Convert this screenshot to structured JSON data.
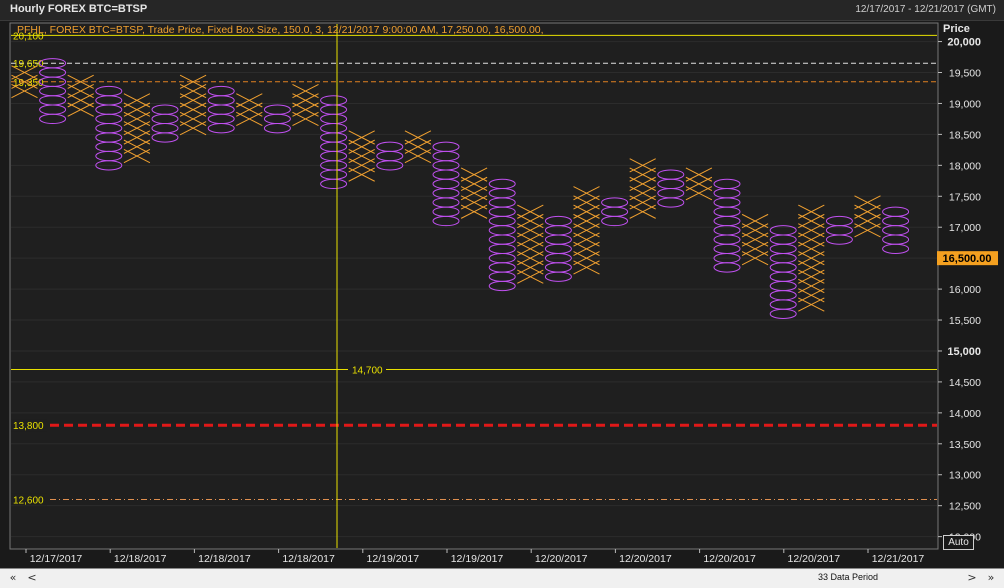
{
  "window": {
    "title": "Hourly FOREX BTC=BTSP",
    "date_range": "12/17/2017 - 12/21/2017 (GMT)"
  },
  "legend_text": "PFHL, FOREX BTC=BTSP, Trade Price, Fixed Box Size, 150.0, 3,  12/21/2017 9:00:00 AM, 17,250.00, 16,500.00,",
  "price_axis_title": "Price",
  "current_price_label": "16,500.00",
  "auto_button_label": "Auto",
  "scrollbar": {
    "first_label": "«",
    "prev_label": "<",
    "status_text": "33 Data Period",
    "next_label": ">",
    "last_label": "»"
  },
  "colors": {
    "background": "#1f1f1f",
    "x_mark": "#f0a030",
    "o_mark": "#c050f0",
    "yellow_line": "#e8e000",
    "red_dashed": "#e01818",
    "orange_dotdash": "#e09050",
    "white_dashed": "#e0e0e0",
    "orange_dashed": "#e08020",
    "current_price_bg": "#f4a020"
  },
  "chart_data": {
    "type": "point-and-figure",
    "box_size": 150,
    "reversal": 3,
    "ylim": [
      11800,
      20300
    ],
    "y_ticks": [
      12000,
      12500,
      13000,
      13500,
      14000,
      14500,
      15000,
      15500,
      16000,
      16500,
      17000,
      17500,
      18000,
      18500,
      19000,
      19500,
      20000
    ],
    "y_tick_labels": [
      "12,000",
      "12,500",
      "13,000",
      "13,500",
      "14,000",
      "14,500",
      "15,000",
      "15,500",
      "16,000",
      "16,500",
      "17,000",
      "17,500",
      "18,000",
      "18,500",
      "19,000",
      "19,500",
      "20,000"
    ],
    "bold_ticks": [
      15000,
      20000
    ],
    "x_labels": [
      "12/17/2017",
      "12/18/2017",
      "12/18/2017",
      "12/18/2017",
      "12/19/2017",
      "12/19/2017",
      "12/20/2017",
      "12/20/2017",
      "12/20/2017",
      "12/20/2017",
      "12/21/2017"
    ],
    "columns": [
      {
        "type": "X",
        "low": 19200,
        "high": 19500
      },
      {
        "type": "O",
        "low": 18750,
        "high": 19650
      },
      {
        "type": "X",
        "low": 18900,
        "high": 19350
      },
      {
        "type": "O",
        "low": 18000,
        "high": 19200
      },
      {
        "type": "X",
        "low": 18150,
        "high": 19050
      },
      {
        "type": "O",
        "low": 18450,
        "high": 18900
      },
      {
        "type": "X",
        "low": 18600,
        "high": 19350
      },
      {
        "type": "O",
        "low": 18600,
        "high": 19200
      },
      {
        "type": "X",
        "low": 18750,
        "high": 19050
      },
      {
        "type": "O",
        "low": 18600,
        "high": 18900
      },
      {
        "type": "X",
        "low": 18750,
        "high": 19200
      },
      {
        "type": "O",
        "low": 17700,
        "high": 19050
      },
      {
        "type": "X",
        "low": 17850,
        "high": 18450
      },
      {
        "type": "O",
        "low": 18000,
        "high": 18300
      },
      {
        "type": "X",
        "low": 18150,
        "high": 18450
      },
      {
        "type": "O",
        "low": 17100,
        "high": 18300
      },
      {
        "type": "X",
        "low": 17250,
        "high": 17850
      },
      {
        "type": "O",
        "low": 16050,
        "high": 17700
      },
      {
        "type": "X",
        "low": 16200,
        "high": 17250
      },
      {
        "type": "O",
        "low": 16200,
        "high": 17100
      },
      {
        "type": "X",
        "low": 16350,
        "high": 17550
      },
      {
        "type": "O",
        "low": 17100,
        "high": 17400
      },
      {
        "type": "X",
        "low": 17250,
        "high": 18000
      },
      {
        "type": "O",
        "low": 17400,
        "high": 17850
      },
      {
        "type": "X",
        "low": 17550,
        "high": 17850
      },
      {
        "type": "O",
        "low": 16350,
        "high": 17700
      },
      {
        "type": "X",
        "low": 16500,
        "high": 17100
      },
      {
        "type": "O",
        "low": 15600,
        "high": 16950
      },
      {
        "type": "X",
        "low": 15750,
        "high": 17250
      },
      {
        "type": "O",
        "low": 16800,
        "high": 17100
      },
      {
        "type": "X",
        "low": 16950,
        "high": 17400
      },
      {
        "type": "O",
        "low": 16650,
        "high": 17250
      }
    ],
    "horizontal_lines": [
      {
        "value": 20100,
        "label": "20,100",
        "style": "solid-yellow"
      },
      {
        "value": 19650,
        "label": "19,650",
        "style": "dashed-white"
      },
      {
        "value": 19350,
        "label": "19,350",
        "style": "dashed-orange"
      },
      {
        "value": 14700,
        "label": "14,700",
        "style": "solid-yellow"
      },
      {
        "value": 13800,
        "label": "13,800",
        "style": "dashed-red"
      },
      {
        "value": 12600,
        "label": "12,600",
        "style": "dotdash-orange"
      }
    ],
    "current_price": 16500
  }
}
